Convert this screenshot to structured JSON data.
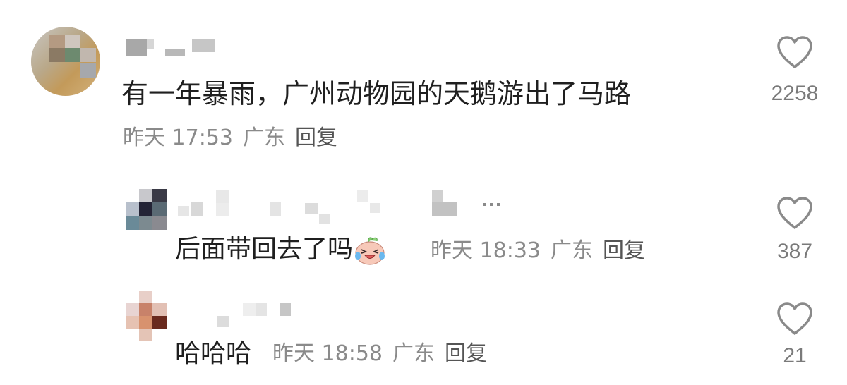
{
  "comments": [
    {
      "text": "有一年暴雨，广州动物园的天鹅游出了马路",
      "time": "昨天 17:53",
      "location": "广东",
      "reply_label": "回复",
      "likes": "2258"
    },
    {
      "text": "后面带回去了吗",
      "time": "昨天 18:33",
      "location": "广东",
      "reply_label": "回复",
      "likes": "387",
      "emoji": "laughing-crying-peach-emoji"
    },
    {
      "text": "哈哈哈",
      "time": "昨天 18:58",
      "location": "广东",
      "reply_label": "回复",
      "likes": "21"
    }
  ],
  "icons": {
    "like": "heart-outline-icon"
  },
  "colors": {
    "text": "#1f1f1f",
    "meta": "#8a8a8a",
    "reply": "#555555",
    "heart_stroke": "#8a8a8a"
  }
}
